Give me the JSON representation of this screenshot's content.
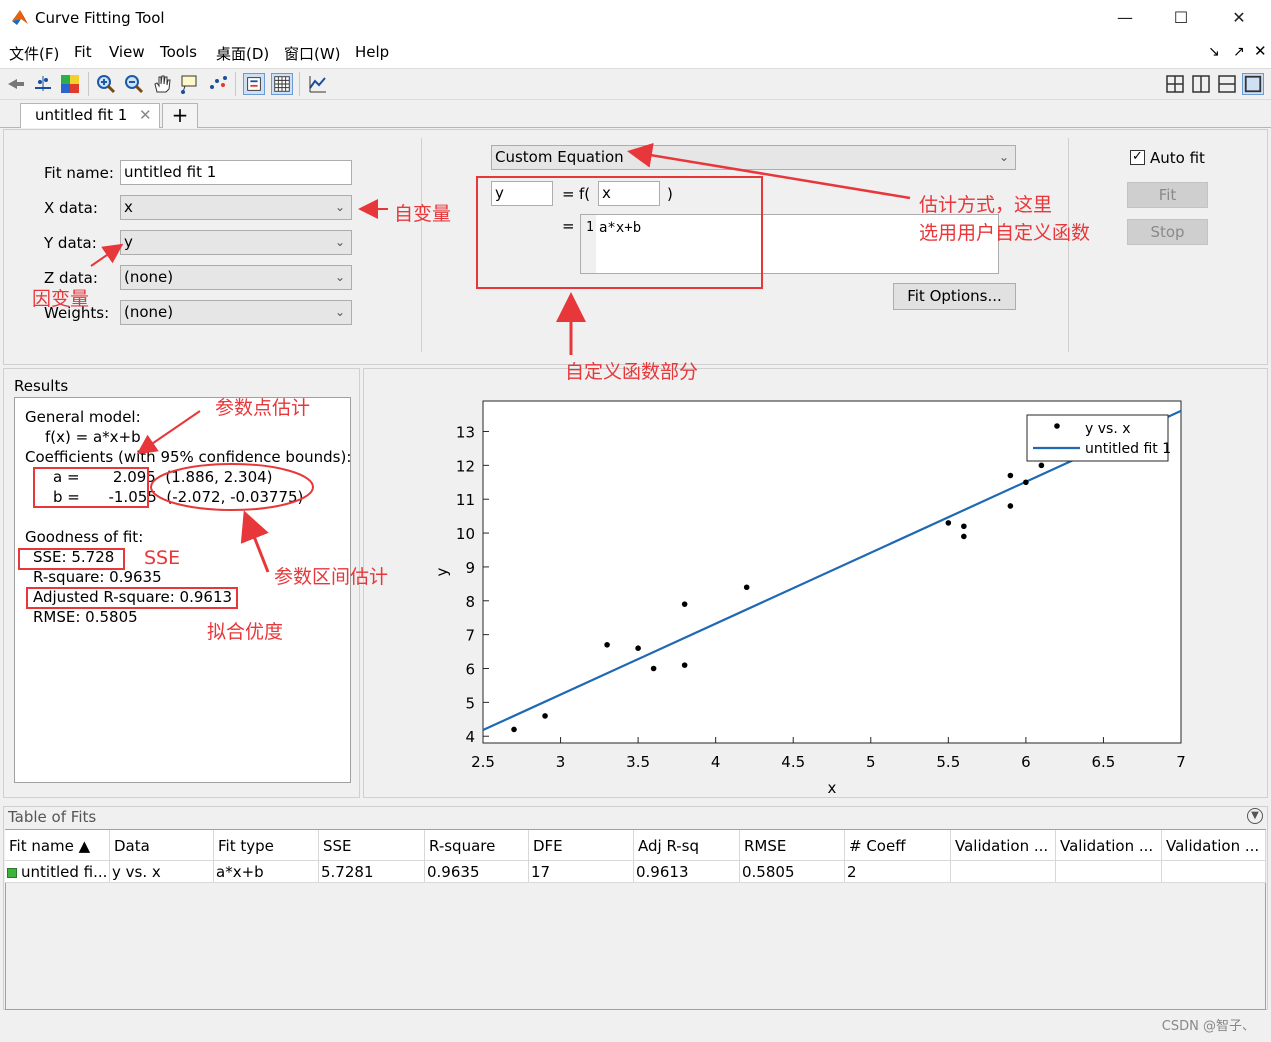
{
  "window": {
    "title": "Curve Fitting Tool"
  },
  "menu": [
    "文件(F)",
    "Fit",
    "View",
    "Tools",
    "桌面(D)",
    "窗口(W)",
    "Help"
  ],
  "tabs": [
    {
      "label": "untitled fit 1"
    }
  ],
  "fit_panel": {
    "fit_name_label": "Fit name:",
    "fit_name_value": "untitled fit 1",
    "x_label": "X data:",
    "x_value": "x",
    "y_label": "Y data:",
    "y_value": "y",
    "z_label": "Z data:",
    "z_value": "(none)",
    "w_label": "Weights:",
    "w_value": "(none)"
  },
  "equation_panel": {
    "fit_type": "Custom Equation",
    "lhs": "y",
    "eq": "=",
    "f_open": "f(",
    "var": "x",
    "f_close": ")",
    "eq2": "=",
    "line_number": "1",
    "equation": "a*x+b",
    "fit_options_label": "Fit Options..."
  },
  "controls": {
    "auto_fit_label": "Auto fit",
    "auto_fit_checked": true,
    "fit_label": "Fit",
    "stop_label": "Stop"
  },
  "results": {
    "title": "Results",
    "general_model": "General model:",
    "model_eq": "f(x) = a*x+b",
    "coeff_header": "Coefficients (with 95% confidence bounds):",
    "a_line": "a =       2.095  (1.886, 2.304)",
    "b_line": "b =      -1.055  (-2.072, -0.03775)",
    "goodness": "Goodness of fit:",
    "sse": "SSE: 5.728",
    "rsq": "R-square: 0.9635",
    "adjrsq": "Adjusted R-square: 0.9613",
    "rmse": "RMSE: 0.5805"
  },
  "annotations": {
    "independent": "自变量",
    "dependent": "因变量",
    "estimation_line1": "估计方式，这里",
    "estimation_line2": "选用用户自定义函数",
    "custom_func": "自定义函数部分",
    "point_est": "参数点估计",
    "interval_est": "参数区间估计",
    "sse": "SSE",
    "goodness": "拟合优度"
  },
  "chart_data": {
    "type": "scatter",
    "xlabel": "x",
    "ylabel": "y",
    "xlim": [
      2.5,
      7
    ],
    "ylim": [
      3.8,
      13.9
    ],
    "xticks": [
      "2.5",
      "3",
      "3.5",
      "4",
      "4.5",
      "5",
      "5.5",
      "6",
      "6.5",
      "7"
    ],
    "yticks": [
      "4",
      "5",
      "6",
      "7",
      "8",
      "9",
      "10",
      "11",
      "12",
      "13"
    ],
    "grid": false,
    "legend": "top-right",
    "series": [
      {
        "name": "y vs. x",
        "x": [
          2.7,
          2.9,
          3.3,
          3.5,
          3.6,
          3.8,
          3.8,
          4.2,
          5.5,
          5.6,
          5.6,
          5.9,
          5.9,
          6.0,
          6.1
        ],
        "y": [
          4.2,
          4.6,
          6.7,
          6.6,
          6.0,
          7.9,
          6.1,
          8.4,
          10.3,
          10.2,
          9.9,
          11.7,
          10.8,
          11.5,
          12.0
        ]
      },
      {
        "name": "untitled fit 1",
        "a": 2.095,
        "b": -1.055
      }
    ]
  },
  "table": {
    "title": "Table of Fits",
    "columns": [
      "Fit name ▲",
      "Data",
      "Fit type",
      "SSE",
      "R-square",
      "DFE",
      "Adj R-sq",
      "RMSE",
      "# Coeff",
      "Validation ...",
      "Validation ...",
      "Validation ..."
    ],
    "rows": [
      [
        "untitled fi...",
        "y vs. x",
        "a*x+b",
        "5.7281",
        "0.9635",
        "17",
        "0.9613",
        "0.5805",
        "2",
        "",
        "",
        ""
      ]
    ]
  },
  "watermark": "CSDN @智子、"
}
